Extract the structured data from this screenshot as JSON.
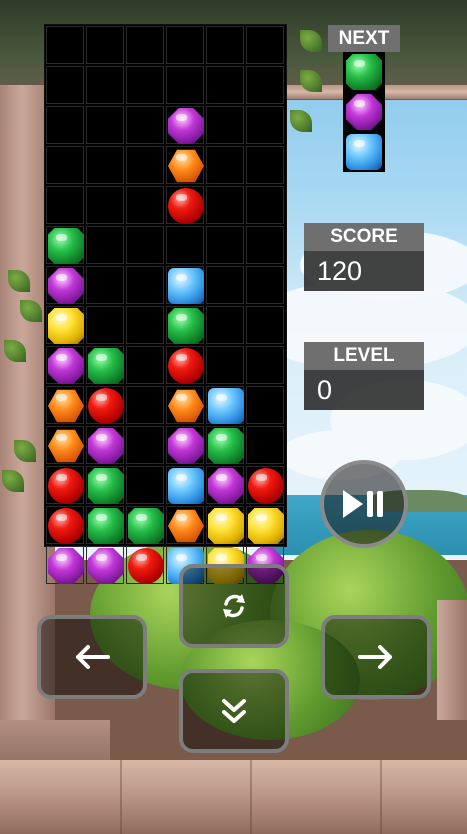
{
  "next": {
    "label": "NEXT",
    "pieces": [
      "green",
      "purple",
      "blue"
    ]
  },
  "score": {
    "label": "SCORE",
    "value": "120"
  },
  "level": {
    "label": "LEVEL",
    "value": "0"
  },
  "controls": {
    "play_pause": "play-pause-icon",
    "rotate": "rotate-icon",
    "left": "arrow-left-icon",
    "right": "arrow-right-icon",
    "drop": "double-chevron-down-icon"
  },
  "board": {
    "columns": 6,
    "rows": 13,
    "cells": [
      [
        null,
        null,
        null,
        null,
        null,
        null
      ],
      [
        null,
        null,
        null,
        null,
        null,
        null
      ],
      [
        null,
        null,
        null,
        "purple",
        null,
        null
      ],
      [
        null,
        null,
        null,
        "orange",
        null,
        null
      ],
      [
        null,
        null,
        null,
        "red",
        null,
        null
      ],
      [
        "green",
        null,
        null,
        null,
        null,
        null
      ],
      [
        "purple",
        null,
        null,
        "blue",
        null,
        null
      ],
      [
        "yellow",
        null,
        null,
        "green",
        null,
        null
      ],
      [
        "purple",
        "green",
        null,
        "red",
        null,
        null
      ],
      [
        "orange",
        "red",
        null,
        "orange",
        "blue",
        null
      ],
      [
        "orange",
        "purple",
        null,
        "purple",
        "green",
        null
      ],
      [
        "red",
        "green",
        null,
        "blue",
        "purple",
        "red"
      ],
      [
        "red",
        "green",
        "green",
        "orange",
        "yellow",
        "yellow"
      ],
      [
        "purple",
        "purple",
        "red",
        "blue",
        "yellow",
        "purple"
      ]
    ]
  },
  "colors": {
    "panel_label_bg": "#6f6f6f",
    "panel_value_bg": "#282828",
    "board_bg": "#000000"
  }
}
